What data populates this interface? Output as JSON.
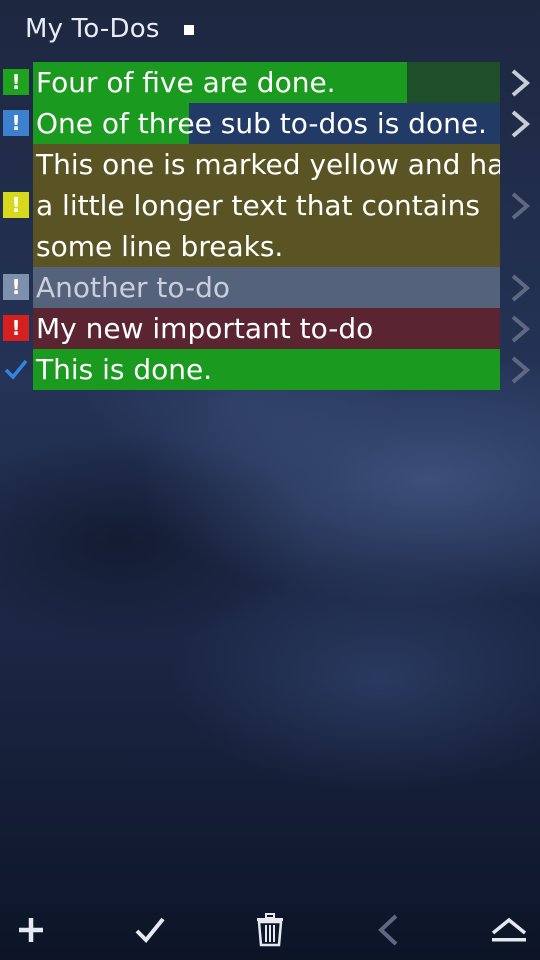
{
  "header": {
    "title": "My To-Dos"
  },
  "todos": [
    {
      "text": "Four of five are done.",
      "priority": "green",
      "progress": 0.8,
      "base_color": "#1f4e2a",
      "fill_color": "#1a9a1e"
    },
    {
      "text": "One of three sub to-dos is done.",
      "priority": "blue",
      "progress": 0.333,
      "base_color": "#223a66",
      "fill_color": "#1a9a1e"
    },
    {
      "text": "This one is marked yellow and has a little longer text that contains some line breaks.",
      "lines": [
        "This one is marked yellow and has",
        "a little longer text that contains",
        "some line breaks."
      ],
      "priority": "yellow",
      "progress": 0,
      "base_color": "#5a5424"
    },
    {
      "text": "Another to-do",
      "priority": "gray",
      "progress": 0,
      "base_color": "#55627c"
    },
    {
      "text": "My new important to-do",
      "priority": "red",
      "progress": 0,
      "base_color": "#5a2430"
    },
    {
      "text": "This is done.",
      "priority": "check",
      "progress": 1,
      "base_color": "#1a9a1e",
      "fill_color": "#1a9a1e"
    }
  ],
  "toolbar": {
    "items": [
      {
        "name": "add",
        "icon": "plus-icon"
      },
      {
        "name": "done",
        "icon": "checkmark-icon"
      },
      {
        "name": "delete",
        "icon": "trash-icon"
      },
      {
        "name": "back",
        "icon": "chevron-left-icon"
      },
      {
        "name": "eject",
        "icon": "eject-icon"
      }
    ]
  },
  "colors": {
    "priority_green": "#1fa31f",
    "priority_blue": "#3c80d0",
    "priority_yellow": "#d8d81c",
    "priority_gray": "#7e90ac",
    "priority_red": "#d62020",
    "check": "#2f86e0"
  }
}
